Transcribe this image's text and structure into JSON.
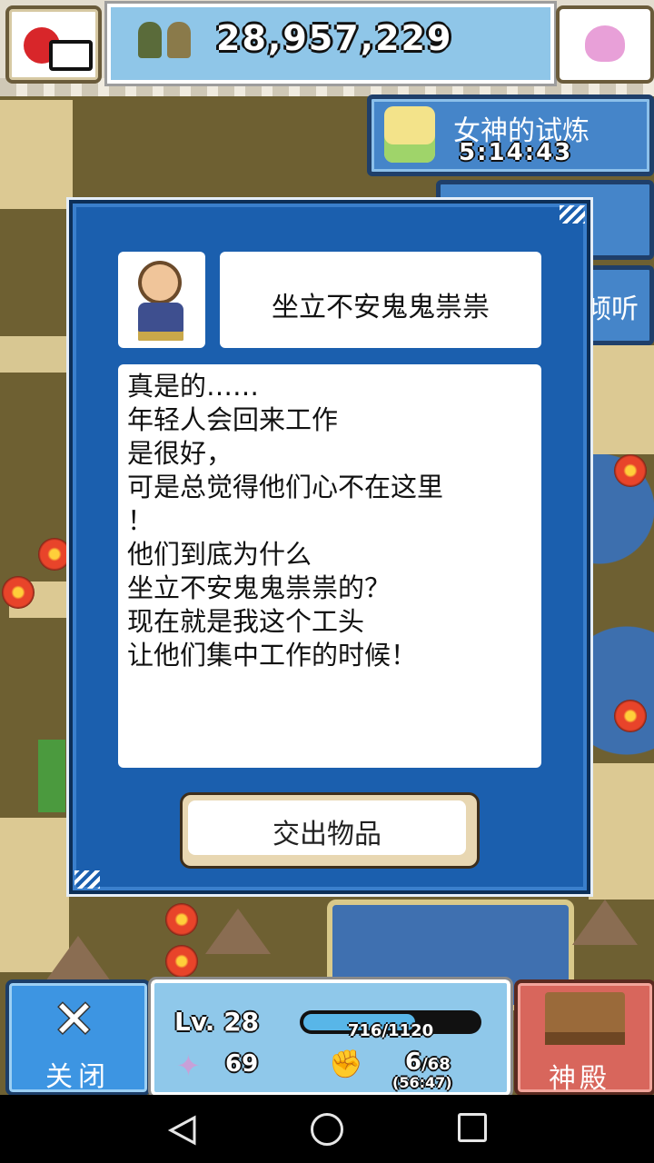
{
  "topbar": {
    "population": "28,957,229",
    "icons": [
      "camera-icon",
      "villagers-icon",
      "rabbit-icon"
    ]
  },
  "goddess_event": {
    "title": "女神的试炼",
    "timer": "5:14:43"
  },
  "side_button": {
    "label": "倾听"
  },
  "dialog": {
    "speaker_name": "坐立不安鬼鬼祟祟",
    "message": "真是的……\n年轻人会回来工作\n是很好，\n可是总觉得他们心不在这里\n！\n他们到底为什么\n坐立不安鬼鬼祟祟的？\n现在就是我这个工头\n让他们集中工作的时候！",
    "hand_over_label": "交出物品"
  },
  "bottom": {
    "close_label": "关闭",
    "level": "Lv. 28",
    "exp_text": "716/1120",
    "exp_fraction": 0.639,
    "power": "69",
    "workers": "6",
    "workers_max": "/68",
    "workers_sub": "(56:47)",
    "temple_label": "神殿"
  },
  "colors": {
    "dialog_blue": "#1b5fae",
    "close_blue": "#3d95e2",
    "temple_red": "#d8665c"
  }
}
